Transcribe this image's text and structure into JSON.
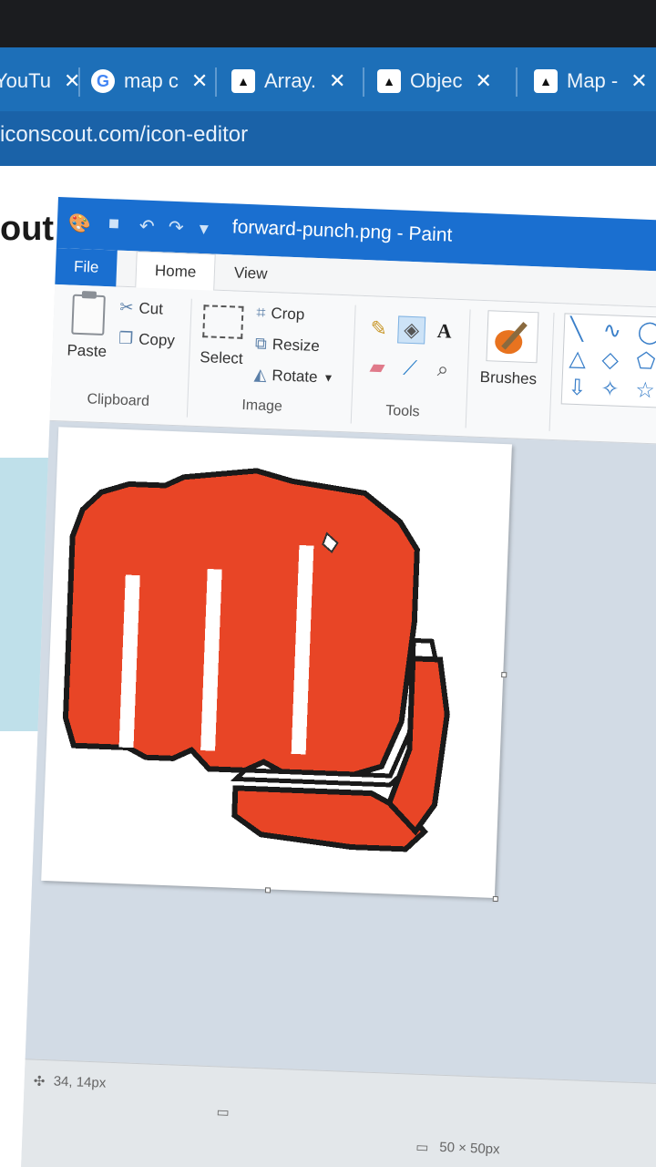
{
  "browser": {
    "tabs": [
      {
        "label": "YouTu",
        "icon": "youtube-icon"
      },
      {
        "label": "map c",
        "icon": "google-icon"
      },
      {
        "label": "Array.",
        "icon": "mdn-dino-icon"
      },
      {
        "label": "Objec",
        "icon": "mdn-dino-icon"
      },
      {
        "label": "Map -",
        "icon": "mdn-dino-icon"
      }
    ],
    "url": "iconscout.com/icon-editor"
  },
  "webpage": {
    "heading_fragment": "out"
  },
  "paint": {
    "title": "forward-punch.png - Paint",
    "menu": {
      "file": "File",
      "home": "Home",
      "view": "View"
    },
    "clipboard": {
      "paste": "Paste",
      "cut": "Cut",
      "copy": "Copy",
      "label": "Clipboard"
    },
    "image": {
      "select": "Select",
      "crop": "Crop",
      "resize": "Resize",
      "rotate": "Rotate",
      "label": "Image"
    },
    "tools": {
      "label": "Tools"
    },
    "brushes": {
      "label": "Brushes"
    },
    "status": {
      "cursor_position": "34, 14px",
      "image_size": "50 × 50px"
    }
  },
  "colors": {
    "punch_fill": "#e84526",
    "punch_outline": "#1a1a1a",
    "accent": "#1a6fd0"
  }
}
